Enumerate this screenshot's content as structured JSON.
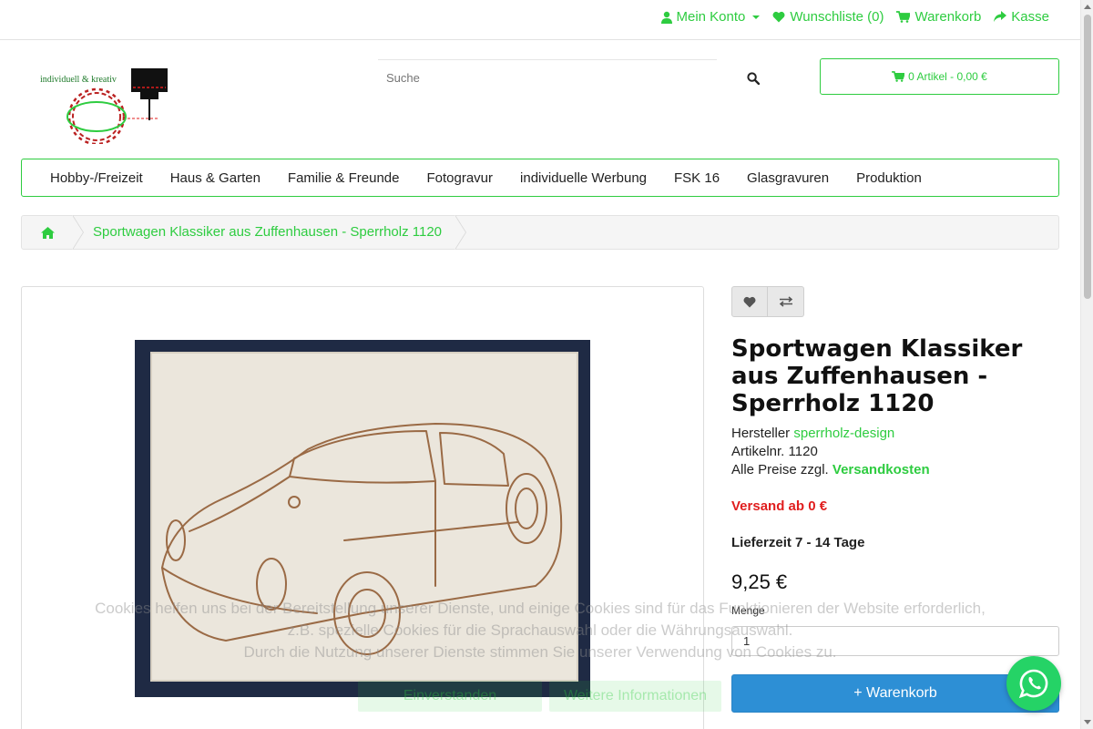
{
  "topbar": {
    "account": "Mein Konto",
    "wishlist": "Wunschliste (0)",
    "cart": "Warenkorb",
    "checkout": "Kasse"
  },
  "logo": {
    "text": "individuell & kreativ"
  },
  "search": {
    "placeholder": "Suche"
  },
  "cartbox": {
    "label": "0 Artikel - 0,00 €"
  },
  "nav": {
    "items": [
      "Hobby-/Freizeit",
      "Haus & Garten",
      "Familie & Freunde",
      "Fotogravur",
      "individuelle Werbung",
      "FSK 16",
      "Glasgravuren",
      "Produktion"
    ]
  },
  "breadcrumb": {
    "current": "Sportwagen Klassiker aus Zuffenhausen - Sperrholz 1120"
  },
  "product": {
    "title": "Sportwagen Klassiker aus Zuffenhausen - Sperrholz 1120",
    "manufacturer_label": "Hersteller",
    "manufacturer": "sperrholz-design",
    "sku_label": "Artikelnr.",
    "sku": "1120",
    "prices_note": "Alle Preise zzgl.",
    "shipping_link": "Versandkosten",
    "shipping_from": "Versand ab 0 €",
    "delivery": "Lieferzeit 7 - 14 Tage",
    "price": "9,25 €",
    "qty_label": "Menge",
    "qty_value": "1",
    "add_to_cart": "+ Warenkorb"
  },
  "cookie": {
    "line1": "Cookies helfen uns bei der Bereitstellung unserer Dienste, und einige Cookies sind für das Funktionieren der Website erforderlich,",
    "line2": "z.B. spezielle Cookies für die Sprachauswahl oder die Währungsauswahl.",
    "line3": "Durch die Nutzung unserer Dienste stimmen Sie unserer Verwendung von Cookies zu.",
    "accept": "Einverstanden",
    "more": "Weitere Informationen"
  },
  "colors": {
    "accent": "#2ecc40",
    "button_blue": "#2d8fd5",
    "shipping_red": "#e01e1e",
    "whatsapp": "#25d366"
  }
}
